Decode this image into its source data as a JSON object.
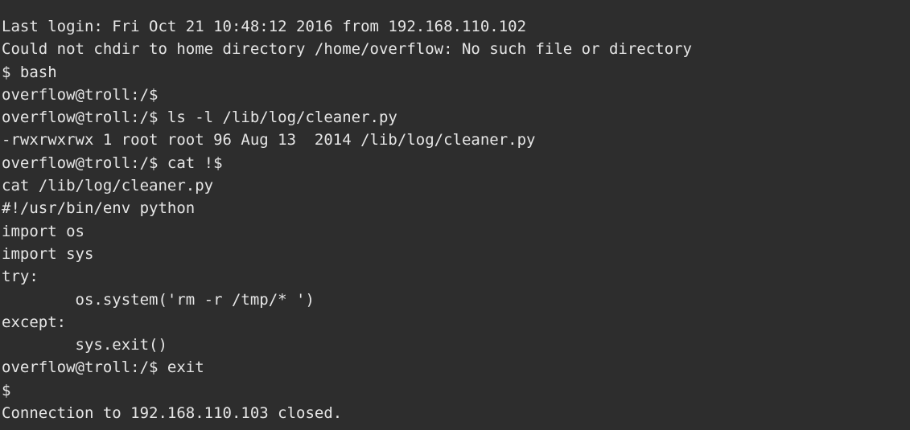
{
  "terminal": {
    "lines": [
      "Last login: Fri Oct 21 10:48:12 2016 from 192.168.110.102",
      "Could not chdir to home directory /home/overflow: No such file or directory",
      "$ bash",
      "overflow@troll:/$",
      "overflow@troll:/$ ls -l /lib/log/cleaner.py",
      "-rwxrwxrwx 1 root root 96 Aug 13  2014 /lib/log/cleaner.py",
      "overflow@troll:/$ cat !$",
      "cat /lib/log/cleaner.py",
      "#!/usr/bin/env python",
      "import os",
      "import sys",
      "try:",
      "        os.system('rm -r /tmp/* ')",
      "except:",
      "        sys.exit()",
      "overflow@troll:/$ exit",
      "$",
      "Connection to 192.168.110.103 closed."
    ]
  },
  "colors": {
    "background": "#2d2d2d",
    "foreground": "#e6e6e6"
  }
}
